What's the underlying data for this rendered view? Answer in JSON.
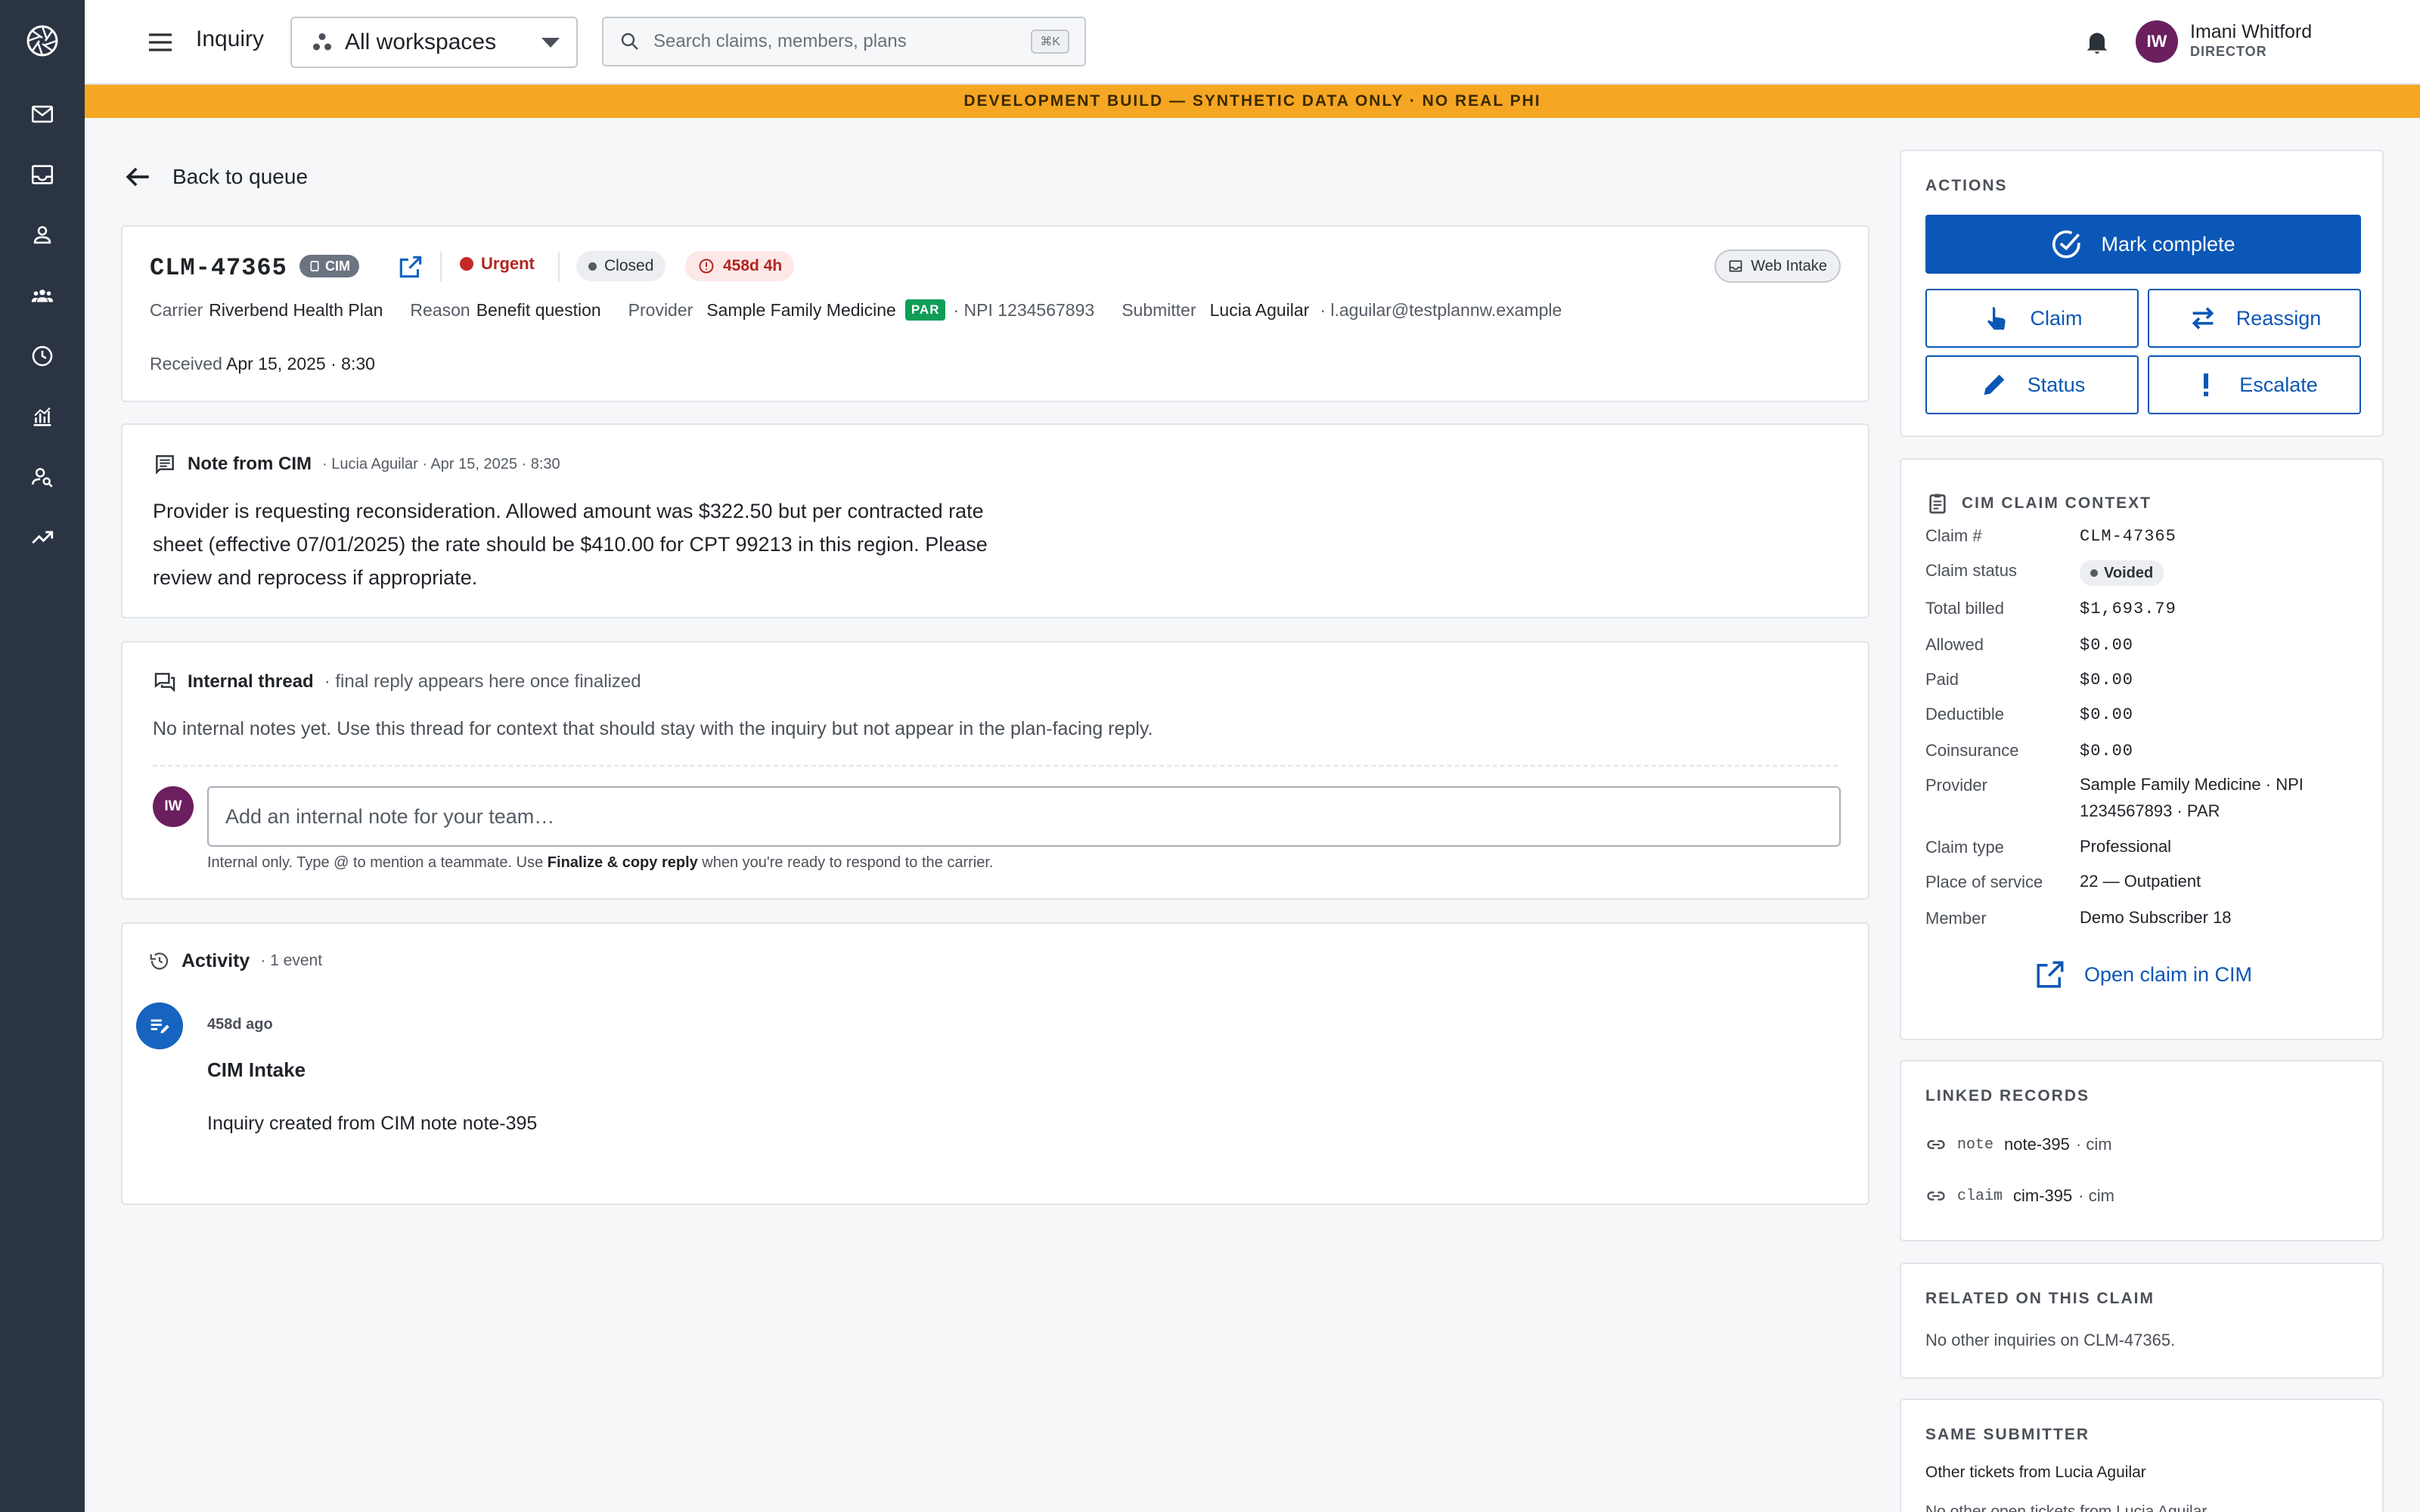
{
  "topbar": {
    "app_title": "Inquiry",
    "workspace": "All workspaces",
    "search_placeholder": "Search claims, members, plans",
    "search_shortcut": "⌘K",
    "user": {
      "initials": "IW",
      "name": "Imani Whitford",
      "role": "DIRECTOR"
    }
  },
  "banner": "DEVELOPMENT BUILD — SYNTHETIC DATA ONLY · NO REAL PHI",
  "back_label": "Back to queue",
  "header": {
    "claim_id": "CLM-47365",
    "source_chip": "CIM",
    "priority": "Urgent",
    "status": "Closed",
    "sla": "458d 4h",
    "channel": "Web Intake",
    "carrier_label": "Carrier",
    "carrier": "Riverbend Health Plan",
    "reason_label": "Reason",
    "reason": "Benefit question",
    "provider_label": "Provider",
    "provider": "Sample Family Medicine",
    "par": "PAR",
    "npi": "· NPI 1234567893",
    "submitter_label": "Submitter",
    "submitter": "Lucia Aguilar",
    "submitter_email": "· l.aguilar@testplannw.example",
    "received_label": "Received",
    "received": "Apr 15, 2025 · 8:30"
  },
  "note": {
    "title": "Note from CIM",
    "meta": "· Lucia Aguilar · Apr 15, 2025 · 8:30",
    "body": "Provider is requesting reconsideration. Allowed amount was $322.50 but per contracted rate sheet (effective 07/01/2025) the rate should be $410.00 for CPT 99213 in this region. Please review and reprocess if appropriate."
  },
  "thread": {
    "title": "Internal thread",
    "meta": "· final reply appears here once finalized",
    "empty": "No internal notes yet. Use this thread for context that should stay with the inquiry but not appear in the plan-facing reply.",
    "avatar": "IW",
    "input_placeholder": "Add an internal note for your team…",
    "hint_a": "Internal only. Type @ to mention a teammate. Use ",
    "hint_b": "Finalize & copy reply",
    "hint_c": " when you're ready to respond to the carrier."
  },
  "activity": {
    "title": "Activity",
    "meta": "· 1 event",
    "time": "458d ago",
    "event_title": "CIM Intake",
    "event_desc": "Inquiry created from CIM note note-395"
  },
  "actions": {
    "label": "ACTIONS",
    "mark_complete": "Mark complete",
    "claim": "Claim",
    "reassign": "Reassign",
    "status": "Status",
    "escalate": "Escalate"
  },
  "context": {
    "label": "CIM CLAIM CONTEXT",
    "rows": [
      {
        "k": "Claim #",
        "v": "CLM-47365"
      },
      {
        "k": "Claim status",
        "v": "Voided"
      },
      {
        "k": "Total billed",
        "v": "$1,693.79"
      },
      {
        "k": "Allowed",
        "v": "$0.00"
      },
      {
        "k": "Paid",
        "v": "$0.00"
      },
      {
        "k": "Deductible",
        "v": "$0.00"
      },
      {
        "k": "Coinsurance",
        "v": "$0.00"
      },
      {
        "k": "Provider",
        "v": "Sample Family Medicine · NPI 1234567893 · PAR"
      },
      {
        "k": "Claim type",
        "v": "Professional"
      },
      {
        "k": "Place of service",
        "v": "22 — Outpatient"
      },
      {
        "k": "Member",
        "v": "Demo Subscriber 18"
      }
    ],
    "open_label": "Open claim in CIM"
  },
  "linked": {
    "label": "LINKED RECORDS",
    "items": [
      {
        "type": "note",
        "id": "note-395",
        "src": "· cim"
      },
      {
        "type": "claim",
        "id": "cim-395",
        "src": "· cim"
      }
    ]
  },
  "related": {
    "label": "RELATED ON THIS CLAIM",
    "text": "No other inquiries on CLM-47365."
  },
  "same_submitter": {
    "label": "SAME SUBMITTER",
    "text": "Other tickets from Lucia Aguilar",
    "text2": "No other open tickets from Lucia Aguilar"
  }
}
